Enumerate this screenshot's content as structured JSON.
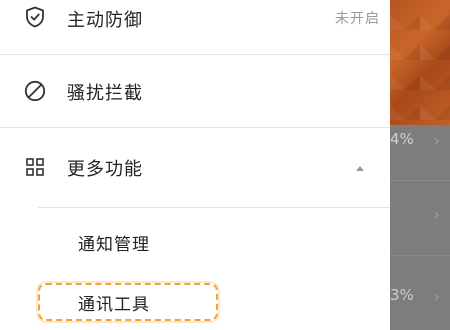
{
  "menu": {
    "active_defense": {
      "label": "主动防御",
      "status": "未开启",
      "icon": "shield-check-icon"
    },
    "harassment_block": {
      "label": "骚扰拦截",
      "icon": "block-icon"
    },
    "more_features": {
      "label": "更多功能",
      "icon": "grid-icon",
      "expanded": true,
      "children": [
        {
          "label": "通知管理"
        },
        {
          "label": "通讯工具"
        }
      ]
    }
  },
  "background": {
    "row1_value": "4%",
    "row3_value": "3%"
  },
  "colors": {
    "highlight": "#f2a23a",
    "header_orange": "#c8662a"
  }
}
